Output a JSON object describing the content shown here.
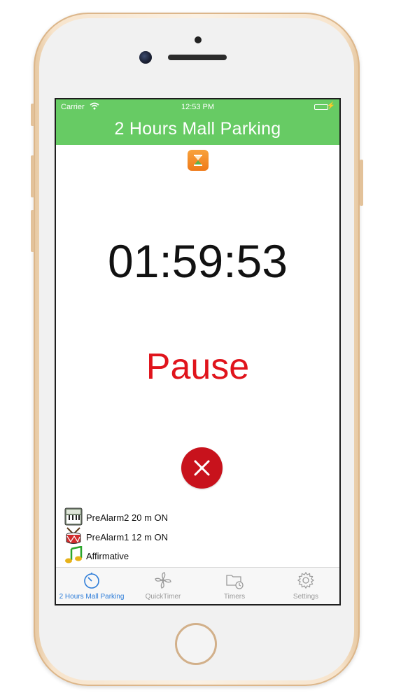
{
  "status_bar": {
    "carrier": "Carrier",
    "time": "12:53 PM"
  },
  "nav": {
    "title": "2 Hours Mall Parking"
  },
  "timer": {
    "value": "01:59:53"
  },
  "controls": {
    "pause_label": "Pause",
    "cancel_icon": "close-icon"
  },
  "alarms": [
    {
      "icon": "piano-icon",
      "label": "PreAlarm2 20 m ON"
    },
    {
      "icon": "drum-icon",
      "label": "PreAlarm1 12 m ON"
    },
    {
      "icon": "music-note-icon",
      "label": "Affirmative"
    }
  ],
  "tabs": [
    {
      "icon": "stopwatch-icon",
      "label": "2 Hours Mall Parking",
      "active": true
    },
    {
      "icon": "fan-icon",
      "label": "QuickTimer",
      "active": false
    },
    {
      "icon": "folder-clock-icon",
      "label": "Timers",
      "active": false
    },
    {
      "icon": "gear-icon",
      "label": "Settings",
      "active": false
    }
  ],
  "colors": {
    "nav_background": "#67cb64",
    "pause_text": "#e0141c",
    "cancel_button": "#c8121c",
    "active_tab": "#2c7cd8",
    "inactive_tab": "#9a9a9a"
  }
}
